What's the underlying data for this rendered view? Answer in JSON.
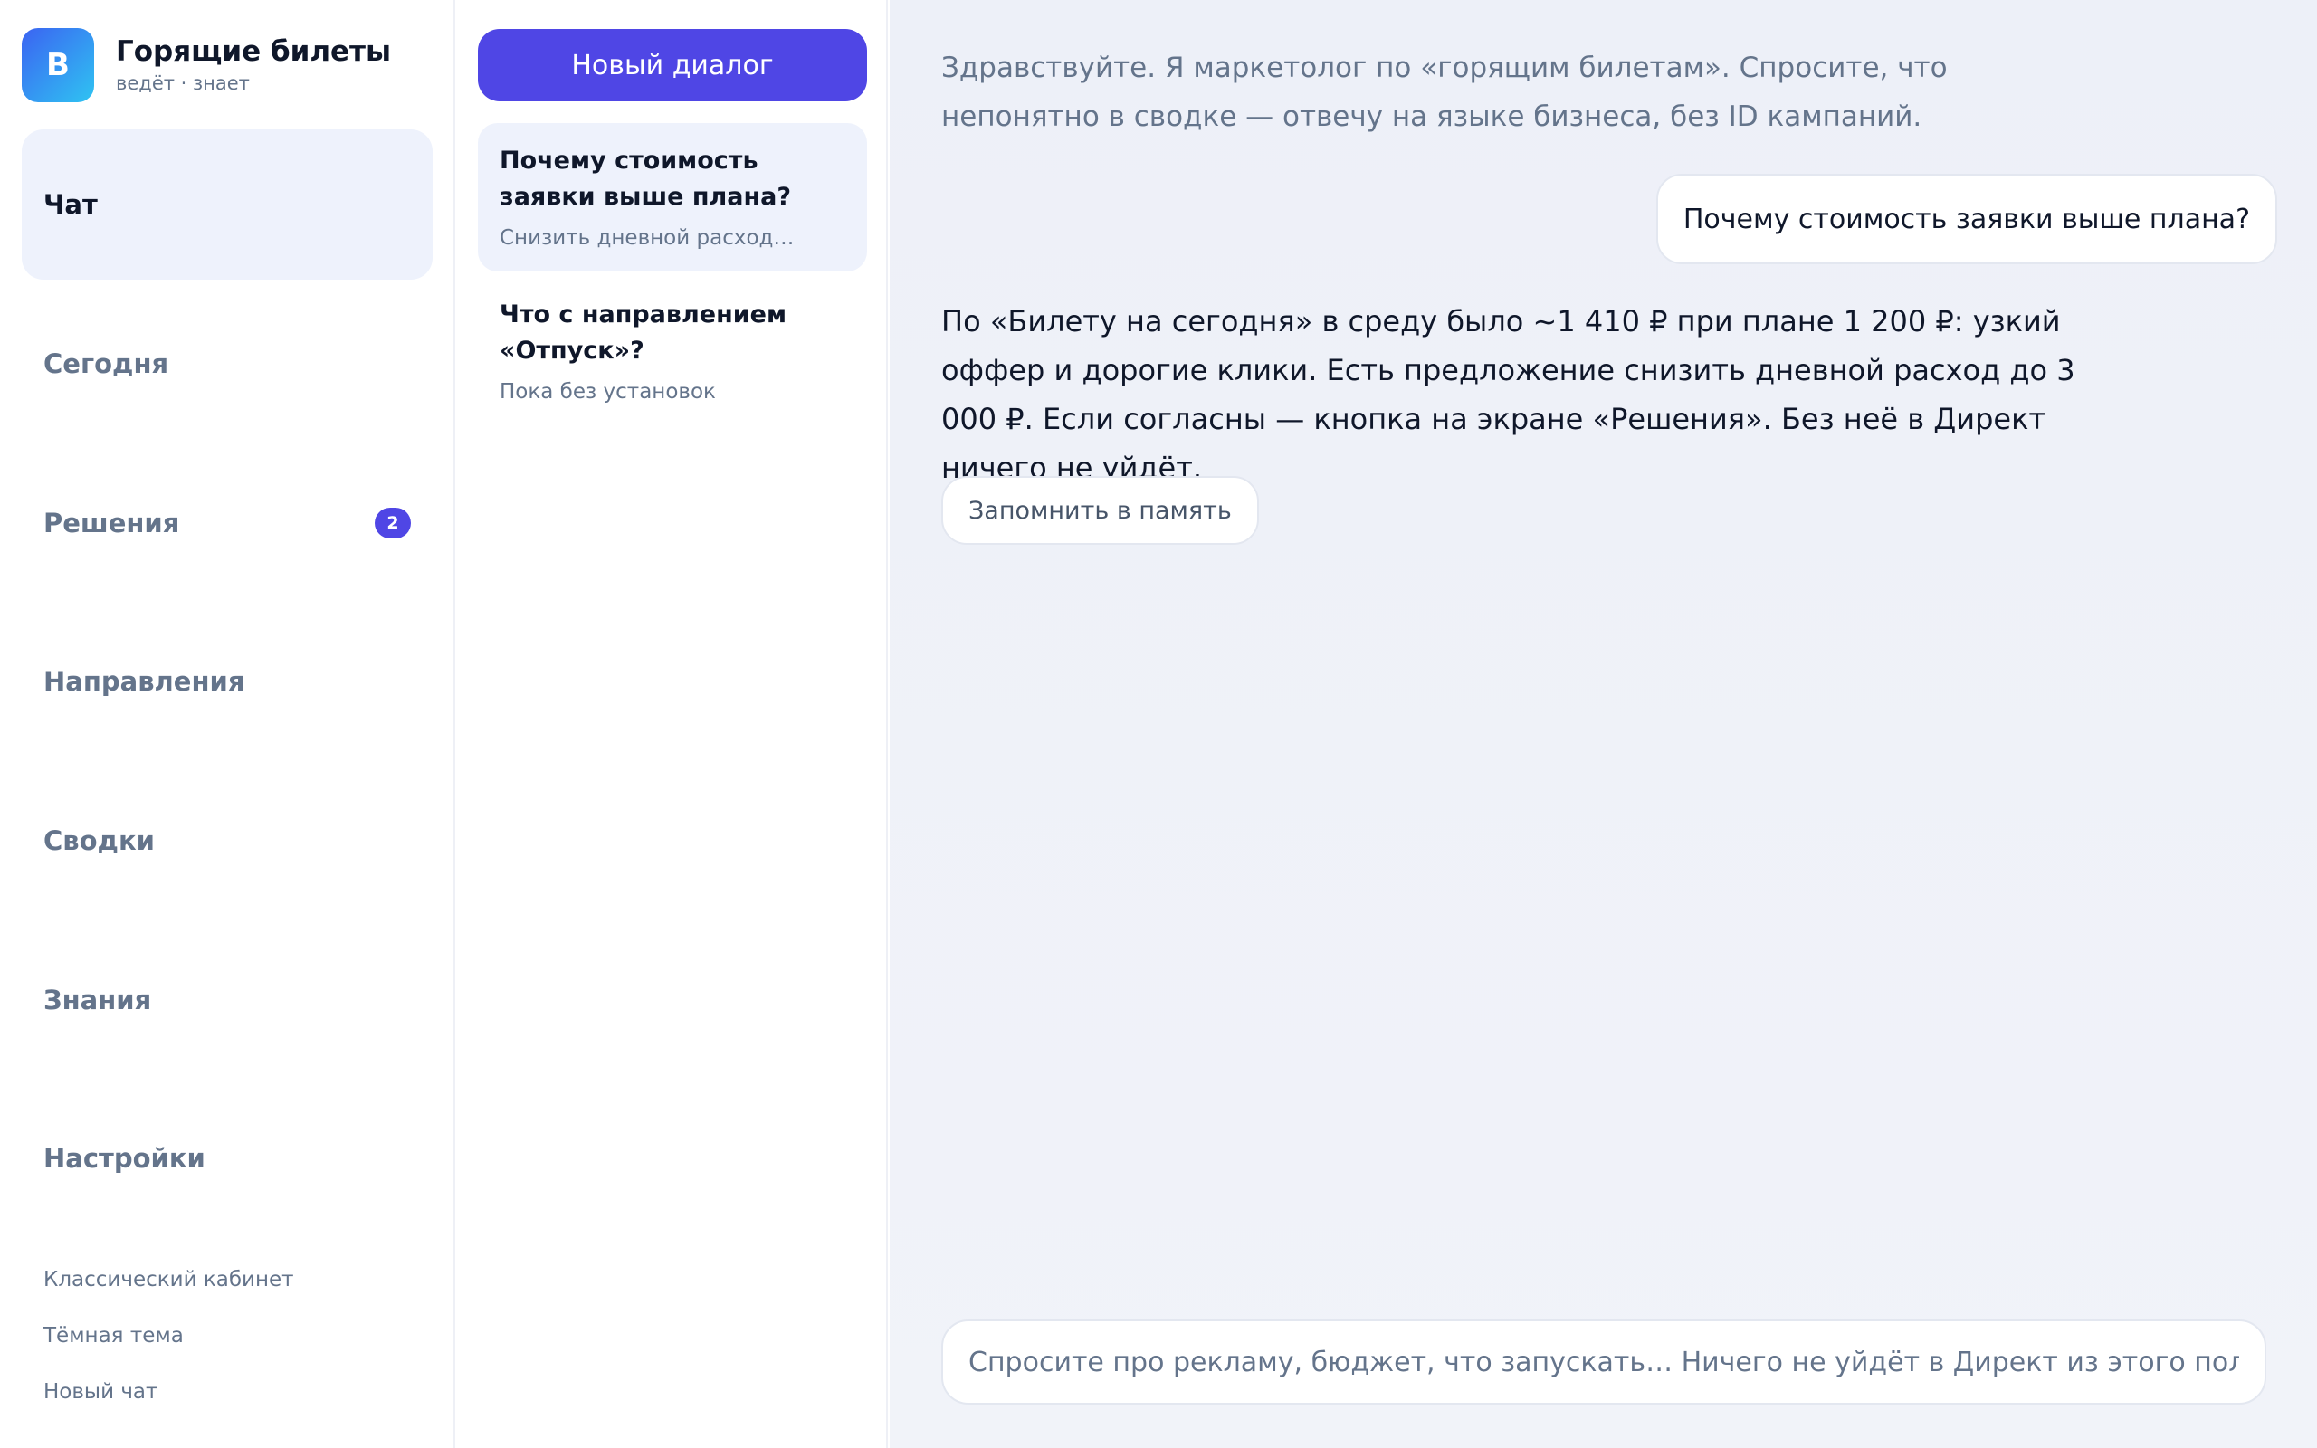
{
  "brand": {
    "logo_letter": "B",
    "title": "Горящие билеты",
    "subtitle": "ведёт · знает",
    "gradient_colors": [
      "#3b63f2",
      "#2fc4f2"
    ]
  },
  "nav": {
    "items": [
      {
        "label": "Чат",
        "active": true
      },
      {
        "label": "Сегодня"
      },
      {
        "label": "Решения",
        "badge": "2"
      },
      {
        "label": "Направления"
      },
      {
        "label": "Сводки"
      },
      {
        "label": "Знания"
      },
      {
        "label": "Настройки"
      }
    ],
    "footer_links": [
      "Классический кабинет",
      "Тёмная тема",
      "Новый чат"
    ]
  },
  "conversations": {
    "new_button_label": "Новый диалог",
    "items": [
      {
        "title": "Почему стоимость заявки выше плана?",
        "preview": "Снизить дневной расход…",
        "active": true
      },
      {
        "title": "Что с направлением «Отпуск»?",
        "preview": "Пока без установок"
      }
    ]
  },
  "chat": {
    "intro": "Здравствуйте. Я маркетолог по «горящим билетам». Спросите, что непонятно в сводке — отвечу на языке бизнеса, без ID кампаний.",
    "user_message": "Почему стоимость заявки выше плана?",
    "assistant_message": "По «Билету на сегодня» в среду было ~1 410 ₽ при плане 1 200 ₽: узкий оффер и дорогие клики. Есть предложение снизить дневной расход до 3 000 ₽. Если согласны — кнопка на экране «Решения». Без неё в Директ ничего не уйдёт.",
    "remember_button_label": "Запомнить в память",
    "composer_placeholder": "Спросите про рекламу, бюджет, что запускать… Ничего не уйдёт в Директ из этого поля."
  },
  "colors": {
    "accent": "#4f46e5",
    "active_bg": "#eef2fc",
    "text_primary": "#0f172a",
    "text_muted": "#64748b"
  }
}
